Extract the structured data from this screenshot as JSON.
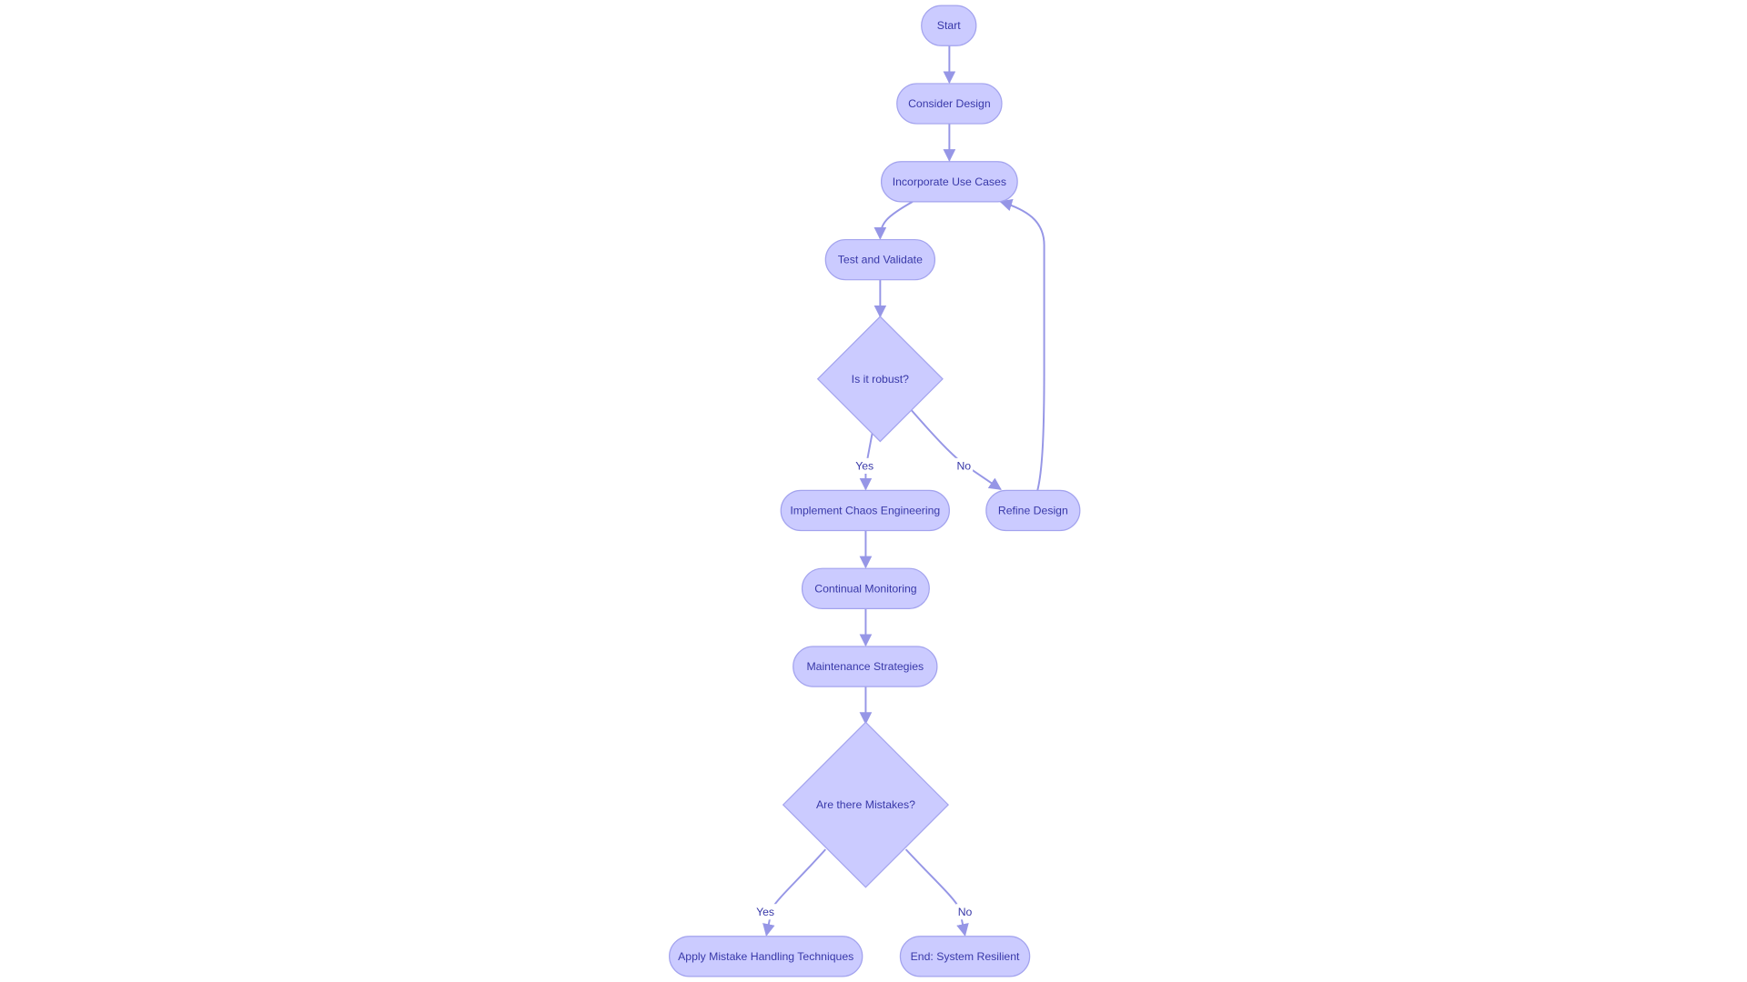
{
  "diagram": {
    "type": "flowchart",
    "colors": {
      "node_fill": "#cbcbff",
      "node_stroke": "#a3a3ee",
      "edge": "#9696e6",
      "text": "#3838a8"
    },
    "nodes": {
      "start": "Start",
      "consider": "Consider Design",
      "incorporate": "Incorporate Use Cases",
      "test": "Test and Validate",
      "robust": "Is it robust?",
      "chaos": "Implement Chaos Engineering",
      "refine": "Refine Design",
      "monitor": "Continual Monitoring",
      "maint": "Maintenance Strategies",
      "mistakes": "Are there Mistakes?",
      "apply": "Apply Mistake Handling Techniques",
      "end": "End: System Resilient"
    },
    "edge_labels": {
      "robust_yes": "Yes",
      "robust_no": "No",
      "mistakes_yes": "Yes",
      "mistakes_no": "No"
    }
  }
}
